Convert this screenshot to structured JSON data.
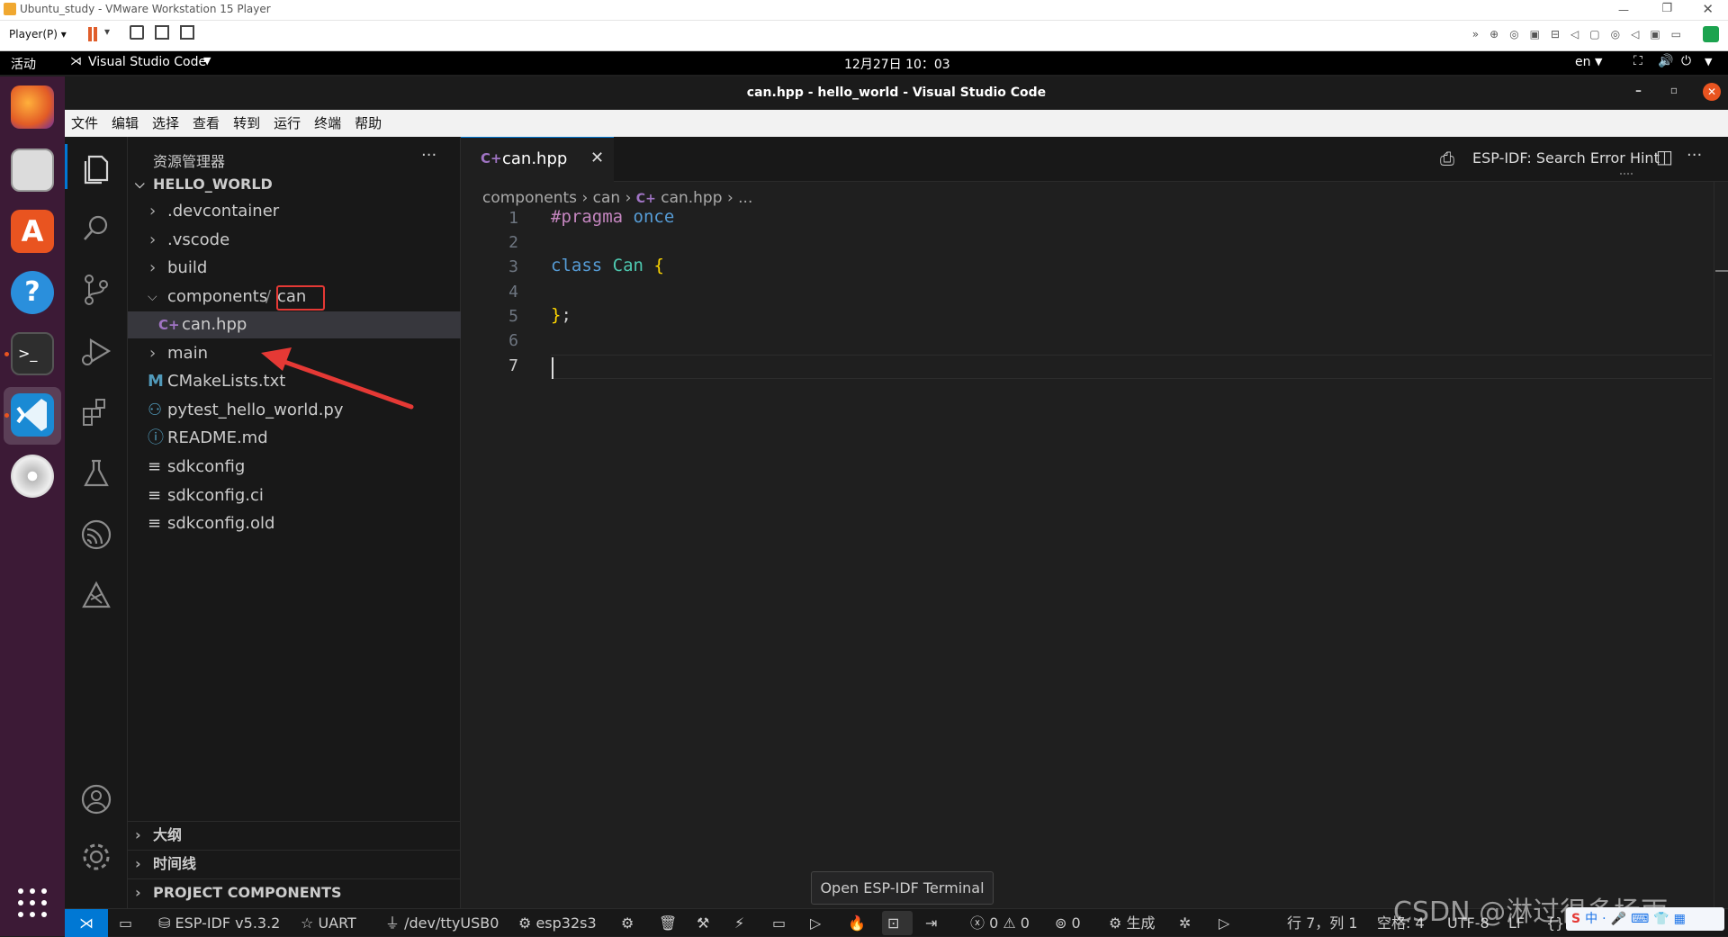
{
  "vmware": {
    "title": "Ubuntu_study - VMware Workstation 15 Player",
    "player_menu": "Player(P)"
  },
  "ubuntu_topbar": {
    "activities": "活动",
    "app_menu": "Visual Studio Code",
    "clock": "12月27日  10：03",
    "input_lang": "en"
  },
  "window": {
    "title": "can.hpp - hello_world - Visual Studio Code"
  },
  "menu": [
    "文件",
    "编辑",
    "选择",
    "查看",
    "转到",
    "运行",
    "终端",
    "帮助"
  ],
  "explorer": {
    "header": "资源管理器",
    "more": "···",
    "workspace": "HELLO_WORLD",
    "items": [
      {
        "label": ".devcontainer",
        "kind": "folder"
      },
      {
        "label": ".vscode",
        "kind": "folder"
      },
      {
        "label": "build",
        "kind": "folder"
      },
      {
        "label": "components",
        "kind": "folder-open",
        "suffix": "can"
      },
      {
        "label": "can.hpp",
        "kind": "cpp-file",
        "selected": true
      },
      {
        "label": "main",
        "kind": "folder"
      },
      {
        "label": "CMakeLists.txt",
        "kind": "cmake-file"
      },
      {
        "label": "pytest_hello_world.py",
        "kind": "python-file"
      },
      {
        "label": "README.md",
        "kind": "info-file"
      },
      {
        "label": "sdkconfig",
        "kind": "text-file"
      },
      {
        "label": "sdkconfig.ci",
        "kind": "text-file"
      },
      {
        "label": "sdkconfig.old",
        "kind": "text-file"
      }
    ],
    "sections": [
      "大纲",
      "时间线",
      "PROJECT COMPONENTS"
    ]
  },
  "editor": {
    "tab_label": "can.hpp",
    "hint_label": "ESP-IDF: Search Error Hint",
    "breadcrumb": [
      "components",
      "can",
      "can.hpp",
      "..."
    ],
    "line_numbers": [
      "1",
      "2",
      "3",
      "4",
      "5",
      "6",
      "7"
    ],
    "code": {
      "l1_kw": "#pragma",
      "l1_rest": "once",
      "l3_kw": "class",
      "l3_name": "Can",
      "l3_brace": "{",
      "l5_brace": "}",
      "l5_semi": ";"
    }
  },
  "tooltip": "Open ESP-IDF Terminal",
  "status": {
    "idf_version": "ESP-IDF v5.3.2",
    "flash_method": "UART",
    "port": "/dev/ttyUSB0",
    "target": "esp32s3",
    "errors": "0",
    "warnings": "0",
    "ports": "0",
    "build": "生成",
    "position": "行 7，列 1",
    "spaces": "空格: 4",
    "encoding": "UTF-8",
    "eol": "LF"
  },
  "watermark": "CSDN @淋过很多场雨",
  "colors": {
    "accent": "#0078d4",
    "annotation_red": "#e53935",
    "keyword": "#c586c0",
    "type": "#4ec9b0",
    "control": "#569cd6"
  }
}
